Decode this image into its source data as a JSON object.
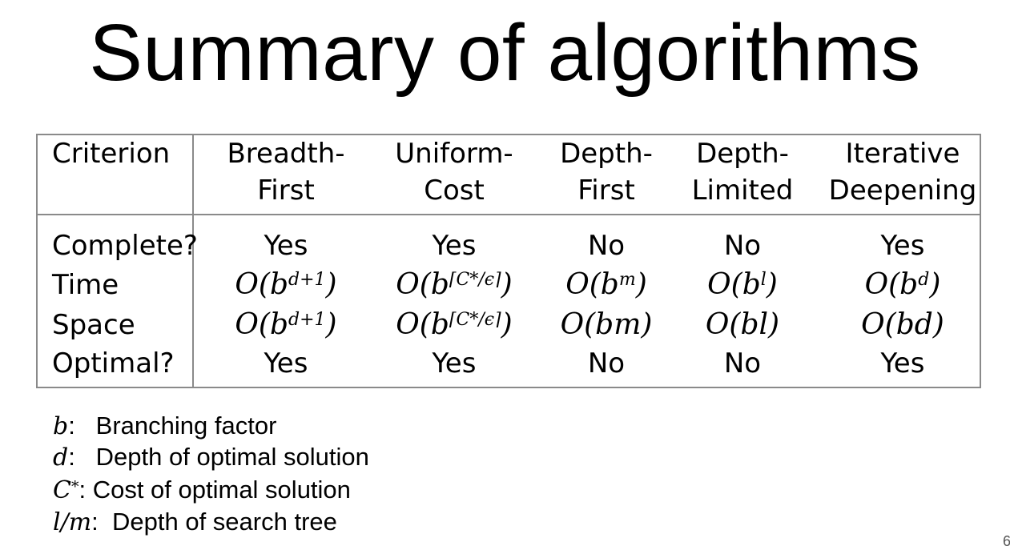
{
  "title": "Summary of algorithms",
  "table": {
    "headers": [
      {
        "line1": "Criterion",
        "line2": ""
      },
      {
        "line1": "Breadth-",
        "line2": "First"
      },
      {
        "line1": "Uniform-",
        "line2": "Cost"
      },
      {
        "line1": "Depth-",
        "line2": "First"
      },
      {
        "line1": "Depth-",
        "line2": "Limited"
      },
      {
        "line1": "Iterative",
        "line2": "Deepening"
      }
    ],
    "rows": [
      {
        "criterion": "Complete?",
        "values": [
          {
            "base": "Yes"
          },
          {
            "base": "Yes"
          },
          {
            "base": "No"
          },
          {
            "base": "No"
          },
          {
            "base": "Yes"
          }
        ]
      },
      {
        "criterion": "Time",
        "values": [
          {
            "base": "O(b",
            "exp": "d+1",
            "close": ")"
          },
          {
            "base": "O(b",
            "exp": "⌈C*/ϵ⌉",
            "close": ")"
          },
          {
            "base": "O(b",
            "exp": "m",
            "close": ")"
          },
          {
            "base": "O(b",
            "exp": "l",
            "close": ")"
          },
          {
            "base": "O(b",
            "exp": "d",
            "close": ")"
          }
        ]
      },
      {
        "criterion": "Space",
        "values": [
          {
            "base": "O(b",
            "exp": "d+1",
            "close": ")"
          },
          {
            "base": "O(b",
            "exp": "⌈C*/ϵ⌉",
            "close": ")"
          },
          {
            "base": "O(bm)"
          },
          {
            "base": "O(bl)"
          },
          {
            "base": "O(bd)"
          }
        ]
      },
      {
        "criterion": "Optimal?",
        "values": [
          {
            "base": "Yes"
          },
          {
            "base": "Yes"
          },
          {
            "base": "No"
          },
          {
            "base": "No"
          },
          {
            "base": "Yes"
          }
        ]
      }
    ]
  },
  "legend": [
    {
      "symbol": "b",
      "symbol_sup": "",
      "text": ":   Branching factor"
    },
    {
      "symbol": "d",
      "symbol_sup": "",
      "text": ":   Depth of optimal solution"
    },
    {
      "symbol": "C",
      "symbol_sup": "*",
      "text": ": Cost of optimal solution"
    },
    {
      "symbol": "l/m",
      "symbol_sup": "",
      "text": ":  Depth of search tree"
    }
  ],
  "page_number": "6"
}
